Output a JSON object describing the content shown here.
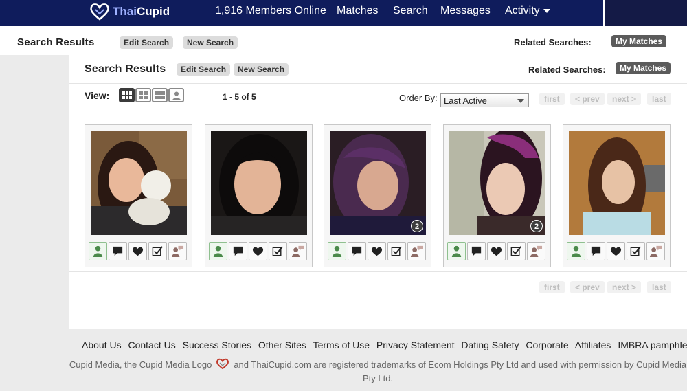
{
  "nav": {
    "logo_thai": "Thai",
    "logo_cupid": "Cupid",
    "members_online": "1,916 Members Online",
    "matches": "Matches",
    "search": "Search",
    "messages": "Messages",
    "activity": "Activity"
  },
  "header": {
    "title": "Search Results",
    "edit_search": "Edit Search",
    "new_search": "New Search",
    "related_searches": "Related Searches:",
    "my_matches": "My Matches"
  },
  "results": {
    "view_label": "View:",
    "count_label": "1 - 5 of 5",
    "order_by_label": "Order By:",
    "order_by_value": "Last Active",
    "pager": {
      "first": "first",
      "prev": "< prev",
      "next": "next >",
      "last": "last"
    }
  },
  "profiles": [
    {
      "photo_badge": ""
    },
    {
      "photo_badge": ""
    },
    {
      "photo_badge": "2"
    },
    {
      "photo_badge": "2"
    },
    {
      "photo_badge": ""
    }
  ],
  "footer": {
    "links": [
      "About Us",
      "Contact Us",
      "Success Stories",
      "Other Sites",
      "Terms of Use",
      "Privacy Statement",
      "Dating Safety",
      "Corporate",
      "Affiliates",
      "IMBRA pamphlet"
    ],
    "legal_part1": "Cupid Media, the Cupid Media Logo",
    "legal_part2": "and ThaiCupid.com are registered trademarks of Ecom Holdings Pty Ltd and used with permission by Cupid Media Pty Ltd."
  },
  "colors": {
    "nav_bg": "#0f1c5c",
    "accent_green": "#8fc08f",
    "pill_dark": "#5b5b5b",
    "heart_red": "#c0392b"
  }
}
